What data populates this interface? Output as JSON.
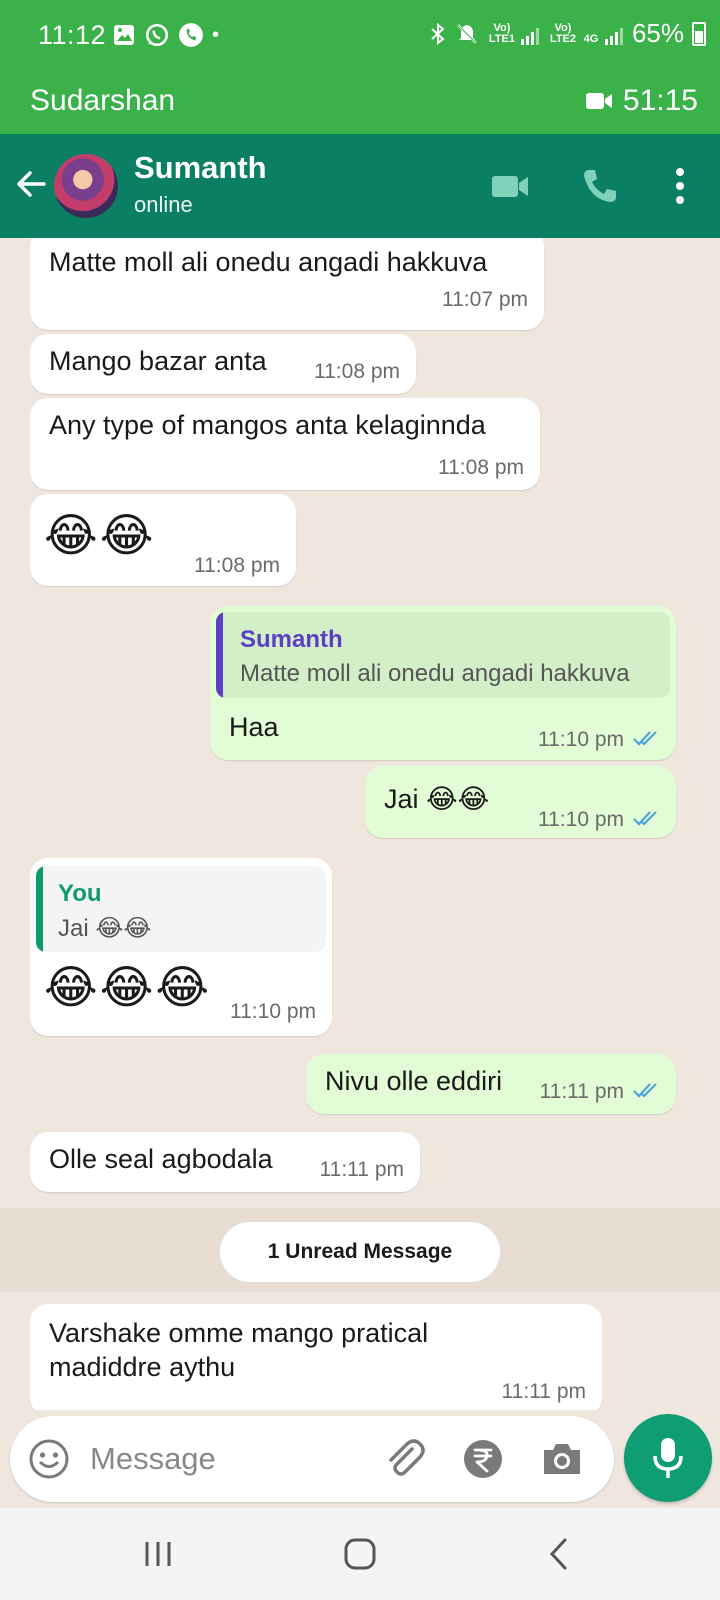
{
  "status_bar": {
    "time": "11:12",
    "battery": "65%",
    "net1": "Vo) LTE1",
    "net2": "Vo) LTE2",
    "net_type": "4G"
  },
  "call_banner": {
    "caller": "Sudarshan",
    "timer": "51:15"
  },
  "header": {
    "name": "Sumanth",
    "status": "online"
  },
  "messages": [
    {
      "text": "Matte moll ali onedu angadi hakkuva",
      "time": "11:07 pm"
    },
    {
      "text": "Mango bazar anta",
      "time": "11:08 pm"
    },
    {
      "text": "Any type of mangos anta kelaginnda",
      "time": "11:08 pm"
    },
    {
      "text": "😂😂",
      "time": "11:08 pm"
    },
    {
      "quote_author": "Sumanth",
      "quote_text": "Matte moll ali onedu angadi hakkuva",
      "text": "Haa",
      "time": "11:10 pm"
    },
    {
      "text": "Jai 😂😂",
      "time": "11:10 pm"
    },
    {
      "quote_author": "You",
      "quote_text": "Jai 😂😂",
      "text": "😂😂😂",
      "time": "11:10 pm"
    },
    {
      "text": "Nivu olle eddiri",
      "time": "11:11 pm"
    },
    {
      "text": "Olle seal agbodala",
      "time": "11:11 pm"
    },
    {
      "text_line1": "Varshake omme mango pratical",
      "text_line2": "madiddre aythu",
      "time": "11:11 pm"
    }
  ],
  "unread_label": "1 Unread Message",
  "input": {
    "placeholder": "Message"
  },
  "colors": {
    "status_green": "#3bb14a",
    "header_teal": "#0b7f63",
    "outgoing_bubble": "#e2fcd5",
    "incoming_bubble": "#ffffff",
    "mic_green": "#0f9d74",
    "read_ticks": "#4fa3e0"
  },
  "icons": [
    "gallery-icon",
    "whatsapp-icon",
    "whatsapp-call-icon",
    "bluetooth-icon",
    "mute-icon",
    "signal-icon",
    "battery-icon",
    "video-call-icon",
    "back-arrow-icon",
    "video-icon",
    "phone-icon",
    "more-options-icon",
    "emoji-icon",
    "attach-icon",
    "rupee-icon",
    "camera-icon",
    "mic-icon",
    "recent-apps-icon",
    "home-icon",
    "back-icon"
  ]
}
